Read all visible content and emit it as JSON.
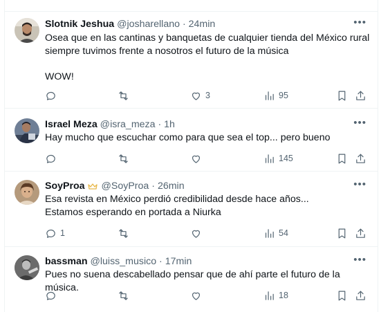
{
  "tweets": [
    {
      "name": "Slotnik Jeshua",
      "handle": "@josharellano",
      "time": "24min",
      "text": "Osea que en las cantinas y banquetas de cualquier tienda del México rural\nsiempre tuvimos frente a nosotros el futuro de la música\n\nWOW!",
      "replies": "",
      "retweets": "",
      "likes": "3",
      "views": "95"
    },
    {
      "name": "Israel Meza",
      "handle": "@isra_meza",
      "time": "1h",
      "text": "Hay mucho que escuchar como para que sea el top... pero bueno",
      "replies": "",
      "retweets": "",
      "likes": "",
      "views": "145"
    },
    {
      "name": "SoyProa",
      "handle": "@SoyProa",
      "time": "26min",
      "text": "Esa revista en México perdió credibilidad desde hace años...\nEstamos esperando en portada a Niurka",
      "replies": "1",
      "retweets": "",
      "likes": "",
      "views": "54"
    },
    {
      "name": "bassman",
      "handle": "@luiss_musico",
      "time": "17min",
      "text": "Pues no suena descabellado pensar que de ahí parte el futuro de la música.",
      "replies": "",
      "retweets": "",
      "likes": "",
      "views": "18"
    }
  ],
  "icons": {
    "more": "more-dots-icon",
    "reply": "reply-icon",
    "retweet": "retweet-icon",
    "like": "heart-icon",
    "views": "views-chart-icon",
    "bookmark": "bookmark-icon",
    "share": "share-icon",
    "badge": "verified-badge-icon"
  },
  "colors": {
    "muted": "#536471",
    "text": "#0f1419",
    "badge": "#e8b84a",
    "divider": "#eff3f4"
  }
}
